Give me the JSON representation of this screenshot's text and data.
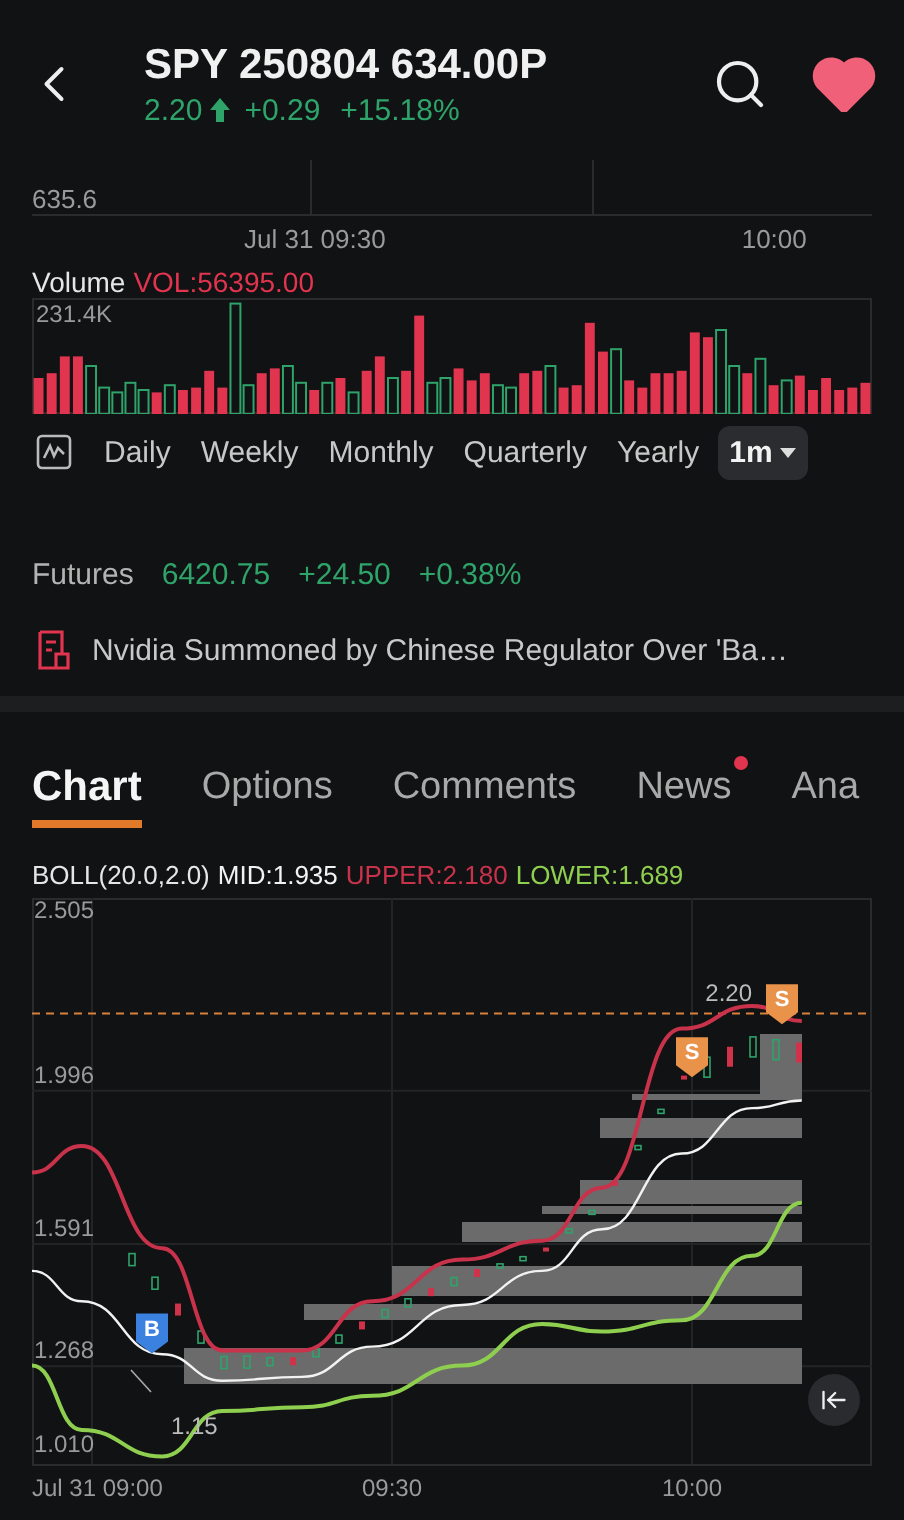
{
  "header": {
    "title": "SPY 250804 634.00P",
    "price": "2.20",
    "change": "+0.29",
    "change_pct": "+15.18%",
    "favorite": true
  },
  "upper_chart": {
    "price_label": "635.6",
    "time_labels": [
      "Jul 31 09:30",
      "10:00"
    ]
  },
  "volume": {
    "label": "Volume",
    "reading": "VOL:56395.00",
    "max_label": "231.4K"
  },
  "periods": [
    {
      "label": "Daily",
      "selected": false
    },
    {
      "label": "Weekly",
      "selected": false
    },
    {
      "label": "Monthly",
      "selected": false
    },
    {
      "label": "Quarterly",
      "selected": false
    },
    {
      "label": "Yearly",
      "selected": false
    },
    {
      "label": "1m",
      "selected": true,
      "dropdown": true
    }
  ],
  "futures": {
    "label": "Futures",
    "price": "6420.75",
    "change": "+24.50",
    "change_pct": "+0.38%"
  },
  "news": {
    "headline": "Nvidia Summoned by Chinese Regulator Over 'Ba…"
  },
  "tabs": [
    {
      "label": "Chart",
      "selected": true,
      "dot": false
    },
    {
      "label": "Options",
      "selected": false,
      "dot": false
    },
    {
      "label": "Comments",
      "selected": false,
      "dot": false
    },
    {
      "label": "News",
      "selected": false,
      "dot": true
    },
    {
      "label": "Ana",
      "selected": false,
      "dot": false
    }
  ],
  "indicator": {
    "name": "BOLL(20.0,2.0)",
    "readings": [
      ":1.935",
      ":2.180",
      ":1.689"
    ]
  },
  "chart_data": {
    "type": "line",
    "x": [
      8.9,
      8.983,
      9.117,
      9.217,
      9.35,
      9.467,
      9.617,
      9.75,
      9.85,
      9.983,
      10.1,
      10.183
    ],
    "series": [
      {
        "name": "MID",
        "color": "#f2f2f2",
        "values": [
          1.52,
          1.44,
          1.3,
          1.23,
          1.24,
          1.32,
          1.43,
          1.52,
          1.63,
          1.83,
          1.95,
          1.97
        ]
      },
      {
        "name": "UPPER",
        "color": "#c8324a",
        "values": [
          1.78,
          1.85,
          1.58,
          1.31,
          1.31,
          1.44,
          1.55,
          1.6,
          1.74,
          2.16,
          2.22,
          2.18
        ]
      },
      {
        "name": "LOWER",
        "color": "#8fcf4f",
        "values": [
          1.27,
          1.1,
          1.03,
          1.15,
          1.16,
          1.19,
          1.27,
          1.38,
          1.36,
          1.39,
          1.56,
          1.7
        ]
      }
    ],
    "xlim": [
      8.9,
      10.3
    ],
    "ylim": [
      1.01,
      2.505
    ],
    "xticks": [
      {
        "value": 9.0,
        "label": "Jul 31 09:00"
      },
      {
        "value": 9.5,
        "label": "09:30"
      },
      {
        "value": 10.0,
        "label": "10:00"
      }
    ],
    "yticks": [
      2.505,
      1.996,
      1.591,
      1.268,
      {
        "value": 1.01,
        "label": "1.010"
      }
    ],
    "grid": true,
    "ref_lines": [
      {
        "axis": "y",
        "value": 2.2,
        "label": "2.20"
      }
    ],
    "annotations": [
      "1.15",
      "B",
      "S",
      "S"
    ]
  }
}
